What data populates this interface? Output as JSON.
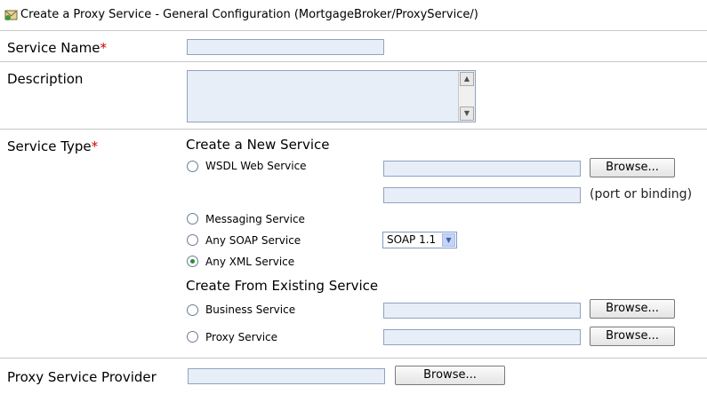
{
  "header": {
    "title": "Create a Proxy Service - General Configuration (MortgageBroker/ProxyService/)"
  },
  "fields": {
    "service_name": {
      "label": "Service Name",
      "required": "*",
      "value": ""
    },
    "description": {
      "label": "Description",
      "value": ""
    },
    "service_type": {
      "label": "Service Type",
      "required": "*"
    },
    "provider": {
      "label": "Proxy Service Provider",
      "value": ""
    }
  },
  "new_service": {
    "title": "Create a New Service",
    "wsdl_label": "WSDL Web Service",
    "port_hint": "(port or binding)",
    "messaging_label": "Messaging Service",
    "soap_label": "Any SOAP Service",
    "soap_version": "SOAP 1.1",
    "xml_label": "Any XML Service",
    "selected": "Any XML Service"
  },
  "existing_service": {
    "title": "Create From Existing Service",
    "business_label": "Business Service",
    "proxy_label": "Proxy Service"
  },
  "buttons": {
    "browse": "Browse..."
  },
  "colors": {
    "required": "#cc0000",
    "field_bg": "#e8eef7",
    "radio_selected": "#2c8a2c"
  }
}
